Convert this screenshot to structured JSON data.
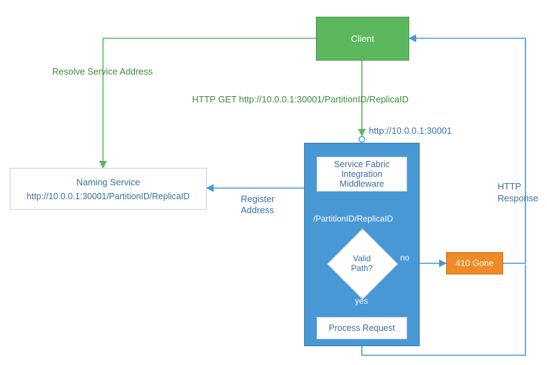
{
  "colors": {
    "green": "#5cb85c",
    "blue": "#4898d5",
    "orange": "#f08a24",
    "text_blue": "#3b6fa5",
    "text_green": "#3d8b3d"
  },
  "nodes": {
    "client": "Client",
    "naming_service_title": "Naming Service",
    "naming_service_url": "http://10.0.0.1:30001/PartitionID/ReplicaID",
    "middleware": "Service Fabric\nIntegration Middleware",
    "valid_path": "Valid\nPath?",
    "process_request": "Process Request",
    "gone": "410 Gone"
  },
  "edges": {
    "resolve": "Resolve Service Address",
    "http_get": "HTTP GET http://10.0.0.1:30001/PartitionID/ReplicaID",
    "listen_url": "http://10.0.0.1:30001",
    "register": "Register\nAddress",
    "path_segment": "/PartitionID/ReplicaID",
    "no": "no",
    "yes": "yes",
    "http_response": "HTTP\nResponse"
  },
  "chart_data": {
    "type": "flowchart",
    "nodes": [
      {
        "id": "client",
        "label": "Client",
        "kind": "process",
        "style": "green"
      },
      {
        "id": "naming_service",
        "label": "Naming Service",
        "detail": "http://10.0.0.1:30001/PartitionID/ReplicaID",
        "kind": "service",
        "style": "outline"
      },
      {
        "id": "middleware_container",
        "label": "",
        "kind": "container",
        "style": "blue"
      },
      {
        "id": "middleware",
        "label": "Service Fabric Integration Middleware",
        "kind": "process",
        "parent": "middleware_container"
      },
      {
        "id": "valid_path",
        "label": "Valid Path?",
        "kind": "decision",
        "parent": "middleware_container"
      },
      {
        "id": "process_request",
        "label": "Process Request",
        "kind": "process",
        "parent": "middleware_container"
      },
      {
        "id": "gone",
        "label": "410 Gone",
        "kind": "terminator",
        "style": "orange"
      }
    ],
    "edges": [
      {
        "from": "client",
        "to": "naming_service",
        "label": "Resolve Service Address",
        "style": "green"
      },
      {
        "from": "client",
        "to": "middleware",
        "label": "HTTP GET http://10.0.0.1:30001/PartitionID/ReplicaID",
        "style": "green",
        "annotation": "http://10.0.0.1:30001"
      },
      {
        "from": "middleware_container",
        "to": "naming_service",
        "label": "Register Address",
        "style": "blue"
      },
      {
        "from": "middleware",
        "to": "valid_path",
        "label": "/PartitionID/ReplicaID",
        "style": "white"
      },
      {
        "from": "valid_path",
        "to": "gone",
        "label": "no",
        "style": "white-blue"
      },
      {
        "from": "valid_path",
        "to": "process_request",
        "label": "yes",
        "style": "white"
      },
      {
        "from": "gone",
        "to": "client",
        "label": "HTTP Response",
        "style": "blue"
      },
      {
        "from": "process_request",
        "to": "client",
        "label": "HTTP Response",
        "style": "blue"
      }
    ]
  }
}
